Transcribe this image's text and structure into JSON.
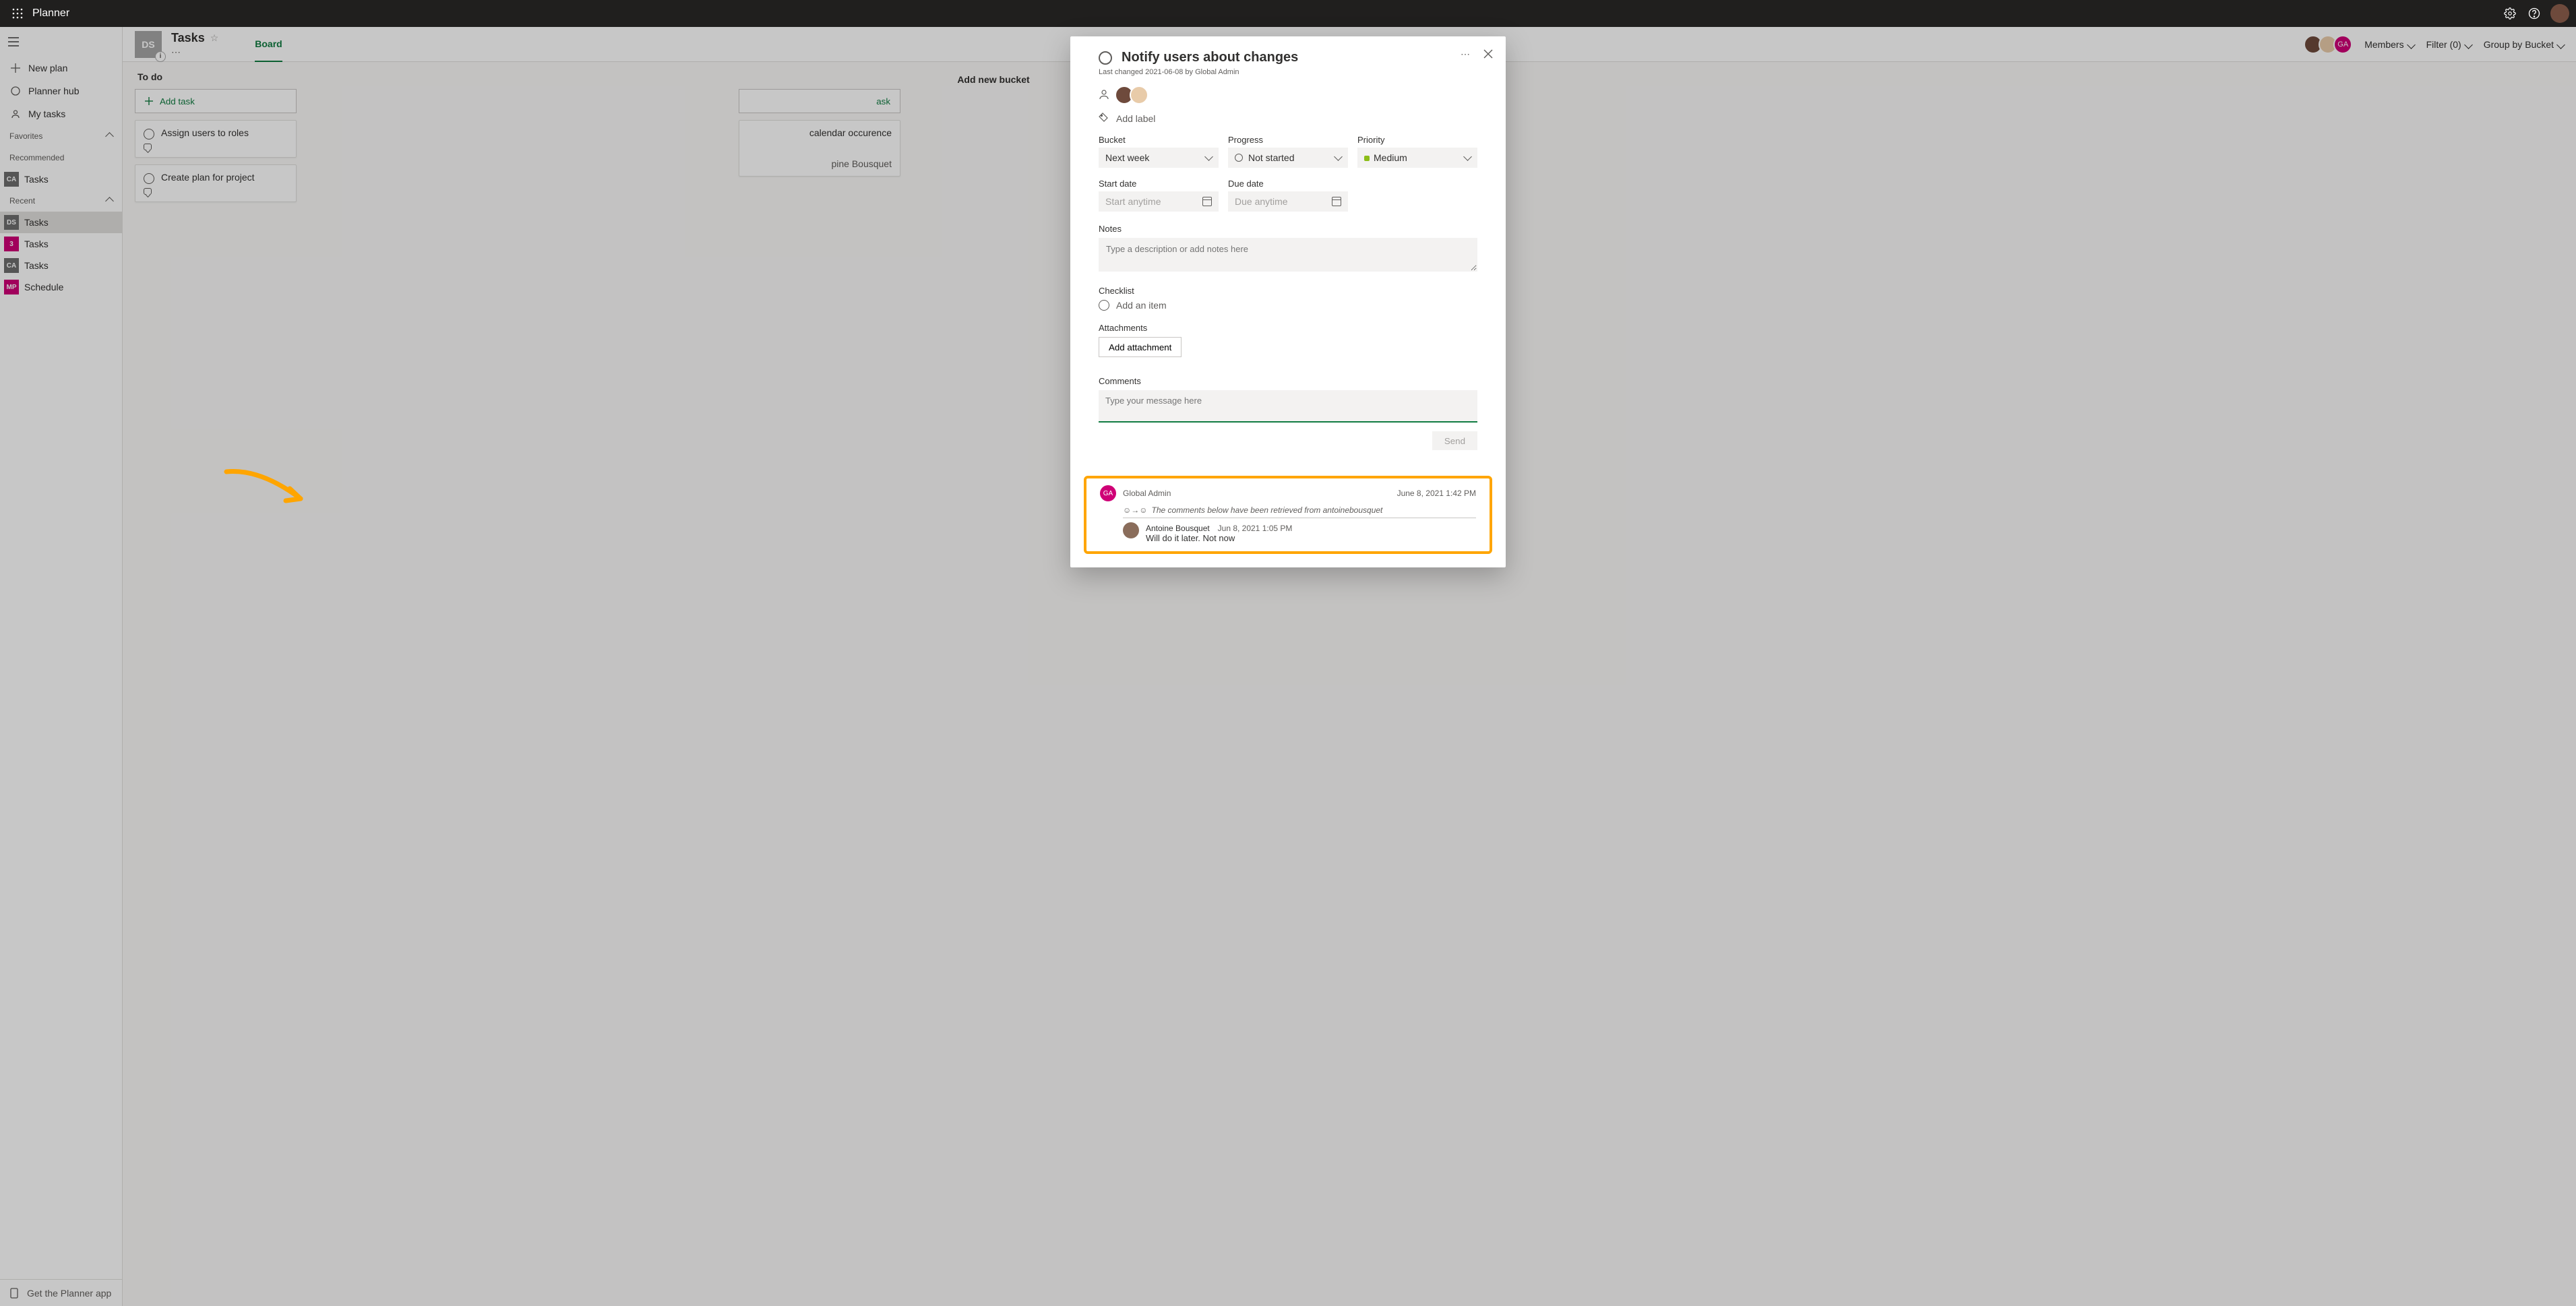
{
  "topbar": {
    "app_name": "Planner"
  },
  "leftnav": {
    "new_plan": "New plan",
    "planner_hub": "Planner hub",
    "my_tasks": "My tasks",
    "favorites": "Favorites",
    "recommended": "Recommended",
    "recommended_items": [
      {
        "initials": "CA",
        "label": "Tasks",
        "color": "#6e6e6e"
      }
    ],
    "recent": "Recent",
    "recent_items": [
      {
        "initials": "DS",
        "label": "Tasks",
        "color": "#6e6e6e",
        "selected": true
      },
      {
        "initials": "3",
        "label": "Tasks",
        "color": "#cf0076"
      },
      {
        "initials": "CA",
        "label": "Tasks",
        "color": "#6e6e6e"
      },
      {
        "initials": "MP",
        "label": "Schedule",
        "color": "#cf0076"
      }
    ],
    "footer": "Get the Planner app"
  },
  "header": {
    "plan_initials": "DS",
    "plan_title": "Tasks",
    "tabs": [
      "Board"
    ],
    "members": "Members",
    "filter": "Filter (0)",
    "group": "Group by Bucket"
  },
  "board": {
    "buckets": [
      {
        "title": "To do",
        "add_task": "Add task",
        "cards": [
          {
            "title": "Assign users to roles"
          },
          {
            "title": "Create plan for project"
          }
        ]
      },
      {
        "title": "",
        "add_task": "ask",
        "cards": [
          {
            "title": "calendar occurence",
            "extra": "pine Bousquet"
          }
        ]
      }
    ],
    "add_bucket": "Add new bucket"
  },
  "modal": {
    "title": "Notify users about changes",
    "last_changed": "Last changed 2021-06-08 by Global Admin",
    "add_label": "Add label",
    "fields": {
      "bucket_label": "Bucket",
      "bucket_value": "Next week",
      "progress_label": "Progress",
      "progress_value": "Not started",
      "priority_label": "Priority",
      "priority_value": "Medium",
      "start_label": "Start date",
      "start_placeholder": "Start anytime",
      "due_label": "Due date",
      "due_placeholder": "Due anytime"
    },
    "notes_label": "Notes",
    "notes_placeholder": "Type a description or add notes here",
    "checklist_label": "Checklist",
    "checklist_add": "Add an item",
    "attachments_label": "Attachments",
    "add_attachment": "Add attachment",
    "comments_label": "Comments",
    "comment_placeholder": "Type your message here",
    "send": "Send",
    "comment1": {
      "author_initials": "GA",
      "author": "Global Admin",
      "date": "June 8, 2021 1:42 PM",
      "retrieved": "The comments below have been retrieved from antoinebousquet"
    },
    "comment2": {
      "author": "Antoine Bousquet",
      "date": "Jun 8, 2021 1:05 PM",
      "text": "Will do it later. Not now"
    }
  }
}
